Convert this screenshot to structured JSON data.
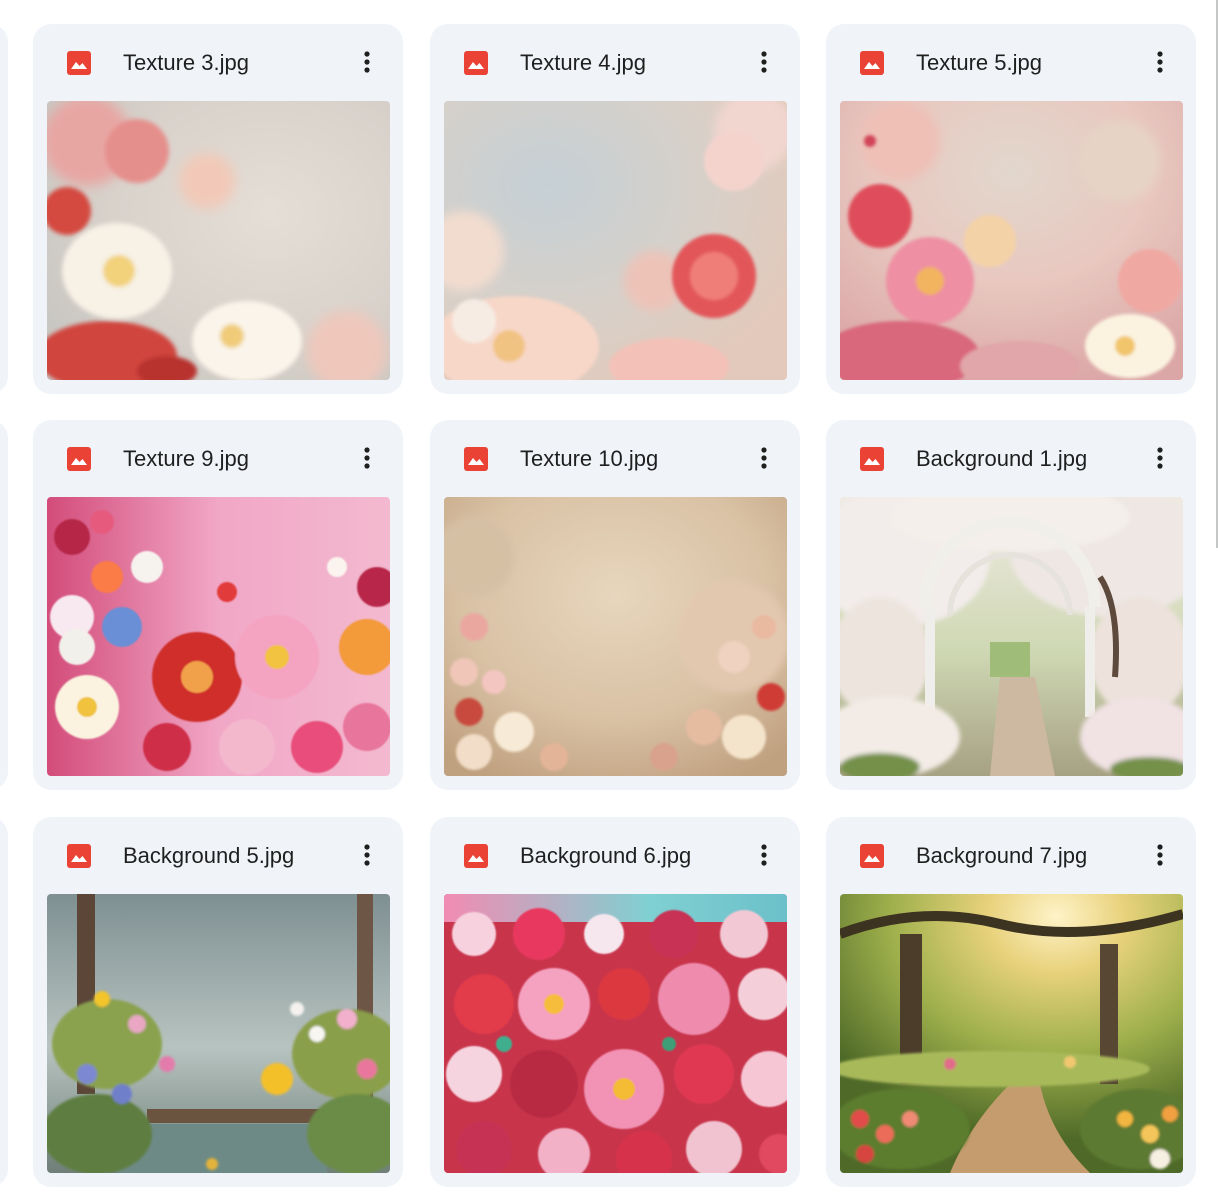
{
  "files": [
    {
      "name": "Texture 3.jpg",
      "type_icon": "image-file-icon",
      "menu_icon": "more-vert-icon"
    },
    {
      "name": "Texture 4.jpg",
      "type_icon": "image-file-icon",
      "menu_icon": "more-vert-icon"
    },
    {
      "name": "Texture 5.jpg",
      "type_icon": "image-file-icon",
      "menu_icon": "more-vert-icon"
    },
    {
      "name": "Texture 9.jpg",
      "type_icon": "image-file-icon",
      "menu_icon": "more-vert-icon"
    },
    {
      "name": "Texture 10.jpg",
      "type_icon": "image-file-icon",
      "menu_icon": "more-vert-icon"
    },
    {
      "name": "Background 1.jpg",
      "type_icon": "image-file-icon",
      "menu_icon": "more-vert-icon"
    },
    {
      "name": "Background 5.jpg",
      "type_icon": "image-file-icon",
      "menu_icon": "more-vert-icon"
    },
    {
      "name": "Background 6.jpg",
      "type_icon": "image-file-icon",
      "menu_icon": "more-vert-icon"
    },
    {
      "name": "Background 7.jpg",
      "type_icon": "image-file-icon",
      "menu_icon": "more-vert-icon"
    }
  ],
  "colors": {
    "card_background": "#f0f4f9",
    "image_icon_red": "#ea4335",
    "text_primary": "#1f1f1f",
    "page_background": "#ffffff"
  }
}
